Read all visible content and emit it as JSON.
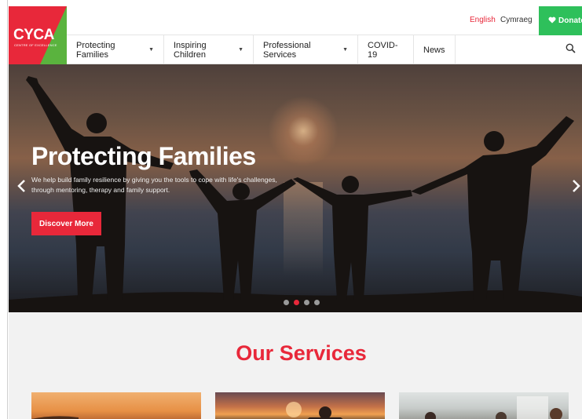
{
  "brand": {
    "logo_text": "CYCA",
    "logo_subtext": "CENTRE OF EXCELLENCE",
    "primary_color": "#e8283a",
    "secondary_color": "#5ab33e",
    "donate_color": "#2ec05b"
  },
  "topbar": {
    "lang_english": "English",
    "lang_welsh": "Cymraeg",
    "donate_icon": "heart-icon",
    "donate_label": "Donate"
  },
  "nav": {
    "items": [
      {
        "label": "Protecting Families",
        "has_dropdown": true
      },
      {
        "label": "Inspiring Children",
        "has_dropdown": true
      },
      {
        "label": "Professional Services",
        "has_dropdown": true
      },
      {
        "label": "COVID-19",
        "has_dropdown": false
      },
      {
        "label": "News",
        "has_dropdown": false
      }
    ],
    "search_icon": "search-icon"
  },
  "hero": {
    "title": "Protecting Families",
    "description": "We help build family resilience by giving you the tools to cope with life's challenges, through mentoring, therapy and family support.",
    "button_label": "Discover More",
    "slides_total": 4,
    "active_slide": 2
  },
  "services": {
    "title": "Our Services"
  }
}
